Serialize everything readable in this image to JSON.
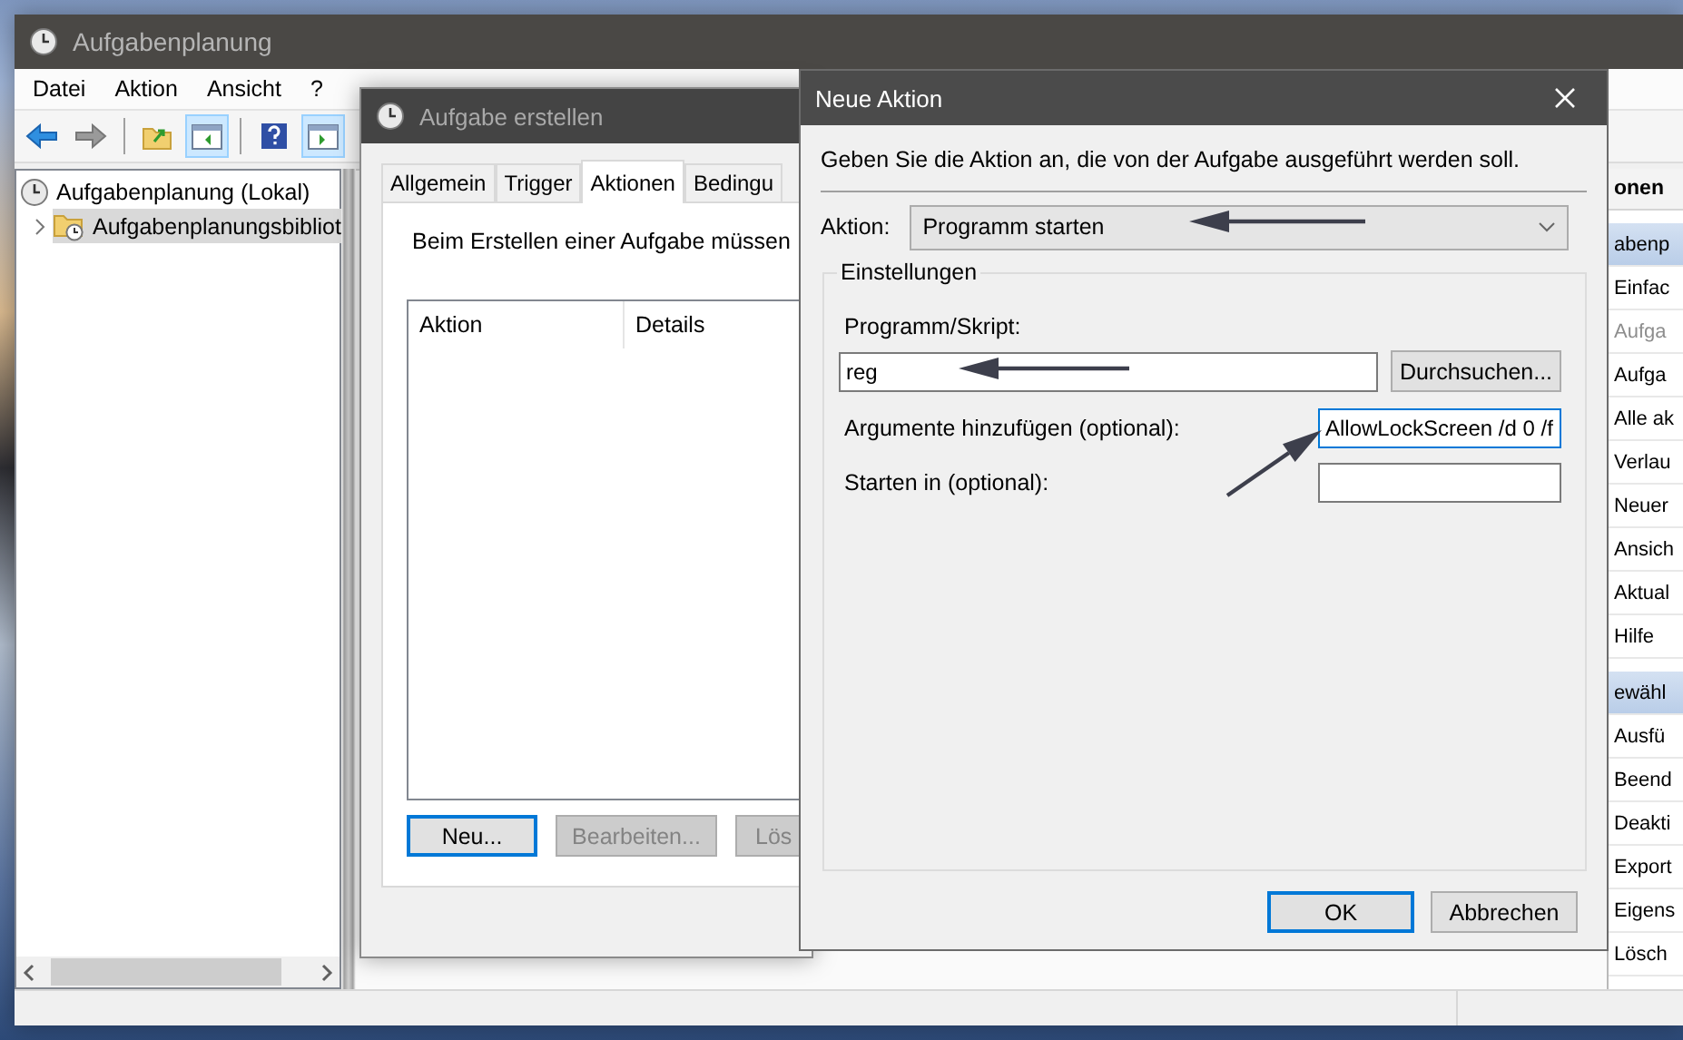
{
  "main_window": {
    "title": "Aufgabenplanung",
    "menu": [
      "Datei",
      "Aktion",
      "Ansicht",
      "?"
    ],
    "toolbar": [
      {
        "kind": "back",
        "pressed": false
      },
      {
        "kind": "forward",
        "pressed": false
      },
      {
        "kind": "separator"
      },
      {
        "kind": "folder_up",
        "pressed": false
      },
      {
        "kind": "console_tree",
        "pressed": true
      },
      {
        "kind": "separator"
      },
      {
        "kind": "help",
        "pressed": false
      },
      {
        "kind": "action_pane",
        "pressed": true
      }
    ],
    "tree": [
      {
        "label": "Aufgabenplanung (Lokal)",
        "selected": false,
        "children": [
          {
            "label": "Aufgabenplanungsbibliot",
            "selected": true,
            "expanded": false
          }
        ]
      }
    ],
    "actions_pane": {
      "title": "onen",
      "items": [
        {
          "kind": "section",
          "label": "abenp"
        },
        {
          "kind": "action",
          "label": "Einfac",
          "disabled": false
        },
        {
          "kind": "action",
          "label": "Aufga",
          "disabled": true
        },
        {
          "kind": "action",
          "label": "Aufga",
          "disabled": false
        },
        {
          "kind": "action",
          "label": "Alle ak",
          "disabled": false
        },
        {
          "kind": "action",
          "label": "Verlau",
          "disabled": false
        },
        {
          "kind": "action",
          "label": "Neuer",
          "disabled": false
        },
        {
          "kind": "action",
          "label": "Ansich",
          "disabled": false
        },
        {
          "kind": "action",
          "label": "Aktual",
          "disabled": false
        },
        {
          "kind": "action",
          "label": "Hilfe",
          "disabled": false
        },
        {
          "kind": "section",
          "label": "ewähl"
        },
        {
          "kind": "action",
          "label": "Ausfü",
          "disabled": false
        },
        {
          "kind": "action",
          "label": "Beend",
          "disabled": false
        },
        {
          "kind": "action",
          "label": "Deakti",
          "disabled": false
        },
        {
          "kind": "action",
          "label": "Export",
          "disabled": false
        },
        {
          "kind": "action",
          "label": "Eigens",
          "disabled": false
        },
        {
          "kind": "action",
          "label": "Lösch",
          "disabled": false
        }
      ]
    }
  },
  "create_task_dialog": {
    "title": "Aufgabe erstellen",
    "tabs": [
      {
        "label": "Allgemein",
        "selected": false
      },
      {
        "label": "Trigger",
        "selected": false
      },
      {
        "label": "Aktionen",
        "selected": true
      },
      {
        "label": "Bedingu",
        "selected": false
      }
    ],
    "description": "Beim Erstellen einer Aufgabe müssen",
    "columns": [
      "Aktion",
      "Details"
    ],
    "buttons": [
      {
        "label": "Neu...",
        "focused": true,
        "disabled": false
      },
      {
        "label": "Bearbeiten...",
        "focused": false,
        "disabled": true
      },
      {
        "label": "Lös",
        "focused": false,
        "disabled": true
      }
    ]
  },
  "new_action_dialog": {
    "title": "Neue Aktion",
    "description": "Geben Sie die Aktion an, die von der Aufgabe ausgeführt werden soll.",
    "action": {
      "label": "Aktion:",
      "value": "Programm starten"
    },
    "group_label": "Einstellungen",
    "program": {
      "label": "Programm/Skript:",
      "value": "reg",
      "button": "Durchsuchen..."
    },
    "arguments": {
      "label": "Argumente hinzufügen (optional):",
      "value": "AllowLockScreen /d 0 /f",
      "focused": true
    },
    "start_in": {
      "label": "Starten in (optional):",
      "focused": false
    },
    "buttons": [
      {
        "label": "OK",
        "focused": true
      },
      {
        "label": "Abbrechen",
        "focused": false
      }
    ]
  }
}
